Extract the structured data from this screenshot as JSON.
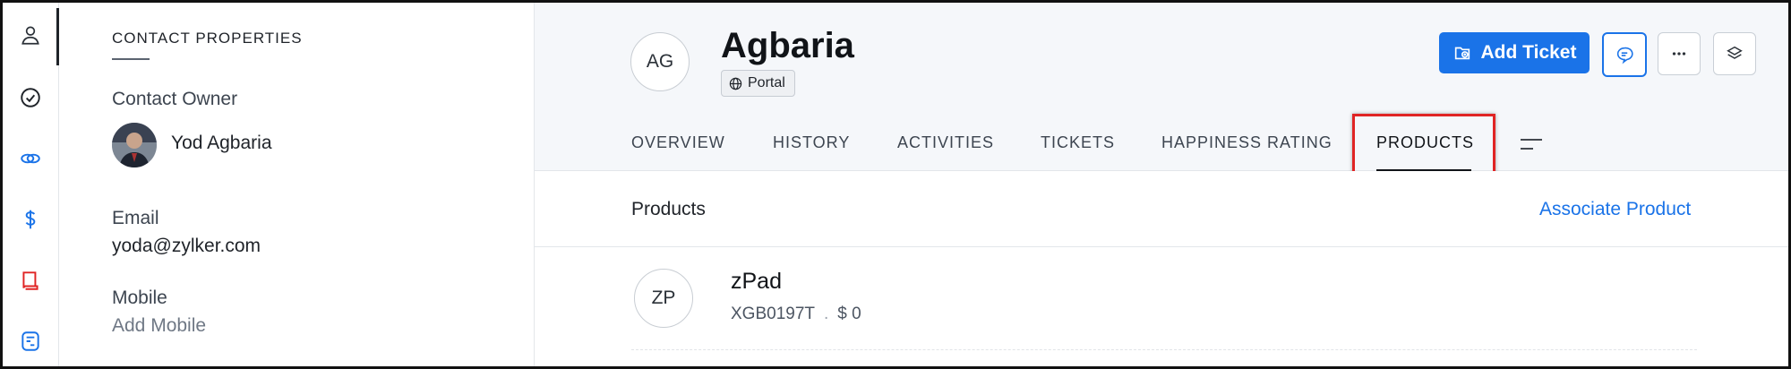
{
  "rail": {
    "items": [
      {
        "icon": "person-icon",
        "active": true
      },
      {
        "icon": "check-circle-icon",
        "active": false
      },
      {
        "icon": "link-icon",
        "active": false
      },
      {
        "icon": "dollar-icon",
        "active": false
      },
      {
        "icon": "book-icon",
        "active": false
      },
      {
        "icon": "route-icon",
        "active": false
      }
    ]
  },
  "properties": {
    "title": "CONTACT PROPERTIES",
    "owner_label": "Contact Owner",
    "owner_name": "Yod Agbaria",
    "email_label": "Email",
    "email_value": "yoda@zylker.com",
    "mobile_label": "Mobile",
    "mobile_value": "Add Mobile"
  },
  "contact": {
    "initials": "AG",
    "name": "Agbaria",
    "channel": "Portal"
  },
  "actions": {
    "add_ticket": "Add Ticket"
  },
  "tabs": [
    {
      "label": "OVERVIEW",
      "active": false
    },
    {
      "label": "HISTORY",
      "active": false
    },
    {
      "label": "ACTIVITIES",
      "active": false
    },
    {
      "label": "TICKETS",
      "active": false
    },
    {
      "label": "HAPPINESS RATING",
      "active": false
    },
    {
      "label": "PRODUCTS",
      "active": true
    }
  ],
  "products_section": {
    "title": "Products",
    "associate_label": "Associate Product",
    "items": [
      {
        "initials": "ZP",
        "name": "zPad",
        "code": "XGB0197T",
        "separator": ".",
        "price": "$ 0"
      }
    ]
  },
  "colors": {
    "accent": "#1a73e8",
    "highlight": "#e02424",
    "header_bg": "#f5f7fa"
  }
}
